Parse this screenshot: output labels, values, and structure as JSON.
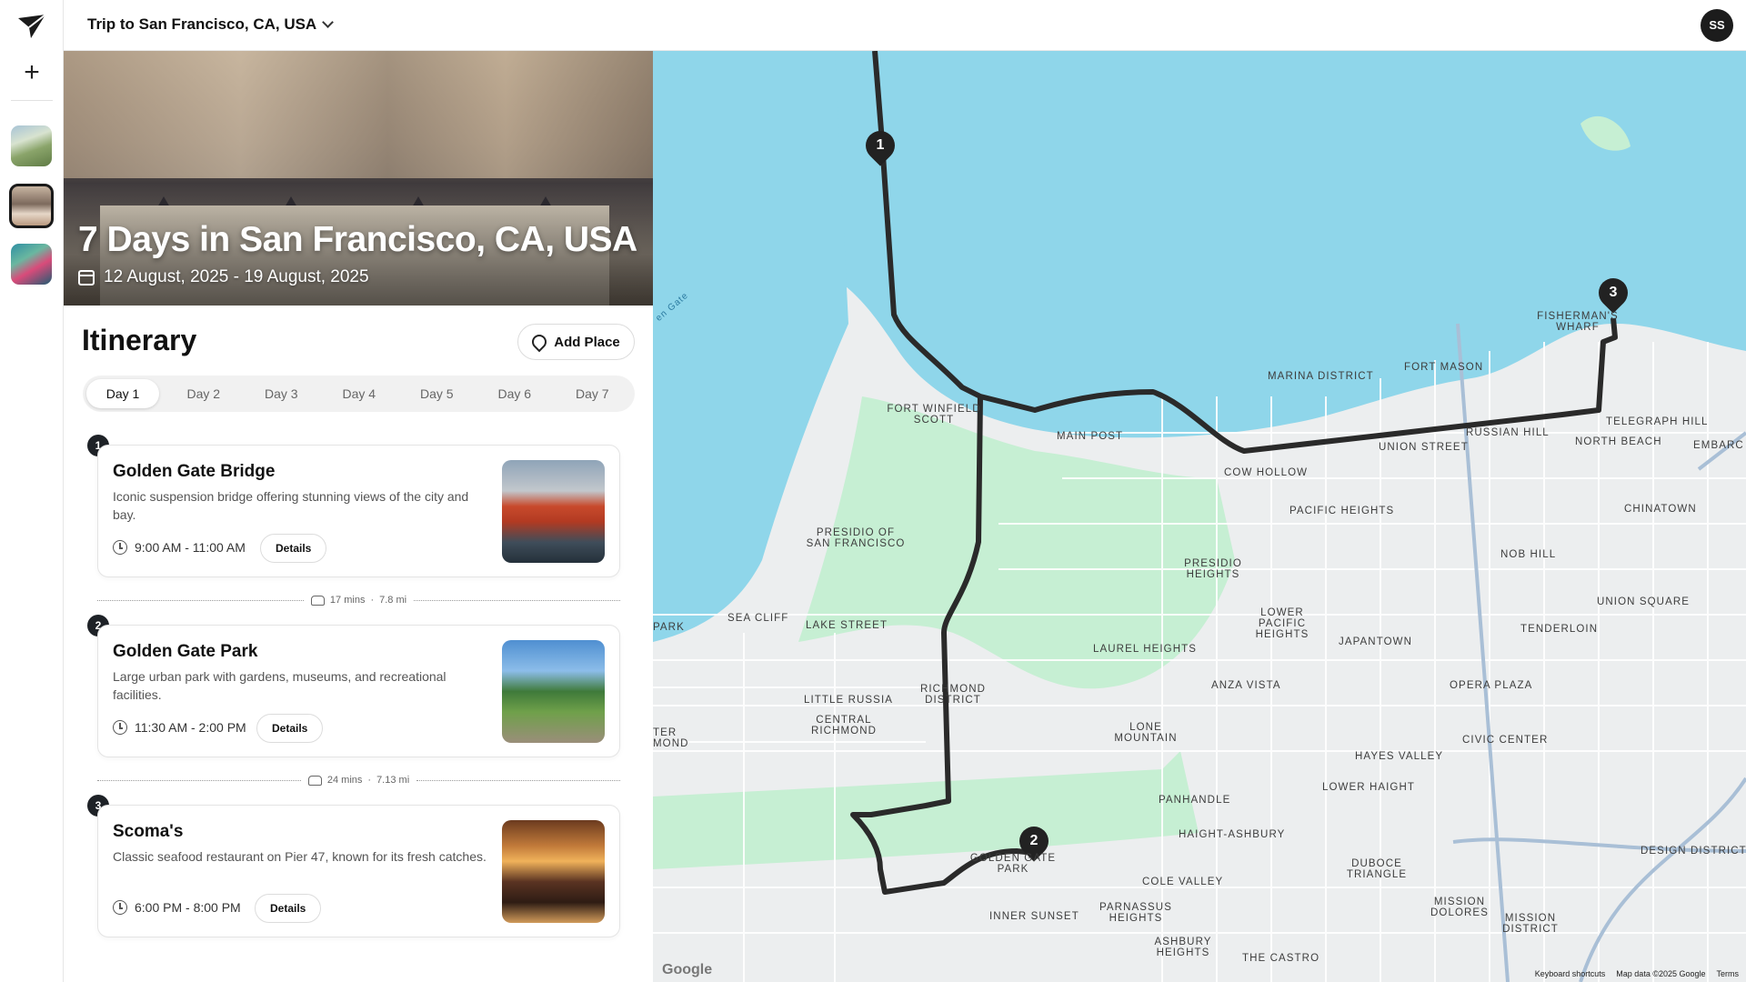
{
  "topbar": {
    "trip_title": "Trip to San Francisco, CA, USA",
    "avatar_initials": "SS"
  },
  "hero": {
    "title": "7 Days in San Francisco, CA, USA",
    "dates": "12 August, 2025 - 19 August, 2025"
  },
  "itinerary": {
    "heading": "Itinerary",
    "add_place_label": "Add Place",
    "tabs": [
      "Day 1",
      "Day 2",
      "Day 3",
      "Day 4",
      "Day 5",
      "Day 6",
      "Day 7"
    ],
    "active_tab": "Day 1",
    "places": [
      {
        "number": "1",
        "name": "Golden Gate Bridge",
        "description": "Iconic suspension bridge offering stunning views of the city and bay.",
        "time": "9:00 AM - 11:00 AM",
        "details_label": "Details"
      },
      {
        "number": "2",
        "name": "Golden Gate Park",
        "description": "Large urban park with gardens, museums, and recreational facilities.",
        "time": "11:30 AM - 2:00 PM",
        "details_label": "Details"
      },
      {
        "number": "3",
        "name": "Scoma's",
        "description": "Classic seafood restaurant on Pier 47, known for its fresh catches.",
        "time": "6:00 PM - 8:00 PM",
        "details_label": "Details"
      }
    ],
    "travel": [
      {
        "duration": "17 mins",
        "distance": "7.8 mi"
      },
      {
        "duration": "24 mins",
        "distance": "7.13 mi"
      }
    ]
  },
  "map": {
    "markers": [
      "1",
      "2",
      "3"
    ],
    "labels": {
      "fishermans_wharf": "FISHERMAN'S WHARF",
      "fort_mason": "FORT MASON",
      "marina_district": "MARINA DISTRICT",
      "fort_winfield_scott": "FORT WINFIELD SCOTT",
      "main_post": "MAIN POST",
      "union_street": "UNION STREET",
      "russian_hill": "RUSSIAN HILL",
      "telegraph_hill": "TELEGRAPH HILL",
      "north_beach": "NORTH BEACH",
      "embarcadero": "EMBARC",
      "cow_hollow": "COW HOLLOW",
      "pacific_heights": "PACIFIC HEIGHTS",
      "chinatown": "CHINATOWN",
      "presidio_of_sf": "PRESIDIO OF SAN FRANCISCO",
      "presidio_heights": "PRESIDIO HEIGHTS",
      "nob_hill": "NOB HILL",
      "union_square": "UNION SQUARE",
      "sea_cliff": "SEA CLIFF",
      "lake_street": "LAKE STREET",
      "lower_pacific_heights": "LOWER PACIFIC HEIGHTS",
      "japantown": "JAPANTOWN",
      "tenderloin": "TENDERLOIN",
      "laurel_heights": "LAUREL HEIGHTS",
      "anza_vista": "ANZA VISTA",
      "opera_plaza": "OPERA PLAZA",
      "richmond_district": "RICHMOND DISTRICT",
      "little_russia": "LITTLE RUSSIA",
      "central_richmond": "CENTRAL RICHMOND",
      "lone_mountain": "LONE MOUNTAIN",
      "civic_center": "CIVIC CENTER",
      "hayes_valley": "HAYES VALLEY",
      "lower_haight": "LOWER HAIGHT",
      "panhandle": "PANHANDLE",
      "haight_ashbury": "HAIGHT-ASHBURY",
      "golden_gate_park": "GOLDEN GATE PARK",
      "cole_valley": "COLE VALLEY",
      "duboce_triangle": "DUBOCE TRIANGLE",
      "design_district": "DESIGN DISTRICT",
      "inner_sunset": "INNER SUNSET",
      "parnassus_heights": "PARNASSUS HEIGHTS",
      "mission_dolores": "MISSION DOLORES",
      "mission_district": "MISSION DISTRICT",
      "ashbury_heights": "ASHBURY HEIGHTS",
      "the_castro": "THE CASTRO",
      "park": "PARK",
      "inner_richmond": "TER MOND",
      "golden_gate_water": "en Gate"
    },
    "attribution": {
      "google": "Google",
      "shortcuts": "Keyboard shortcuts",
      "mapdata": "Map data ©2025 Google",
      "terms": "Terms"
    }
  },
  "colors": {
    "accent": "#1e2227",
    "water": "#8fd6ea",
    "park": "#c6efd3",
    "route": "#2a2a2a"
  }
}
